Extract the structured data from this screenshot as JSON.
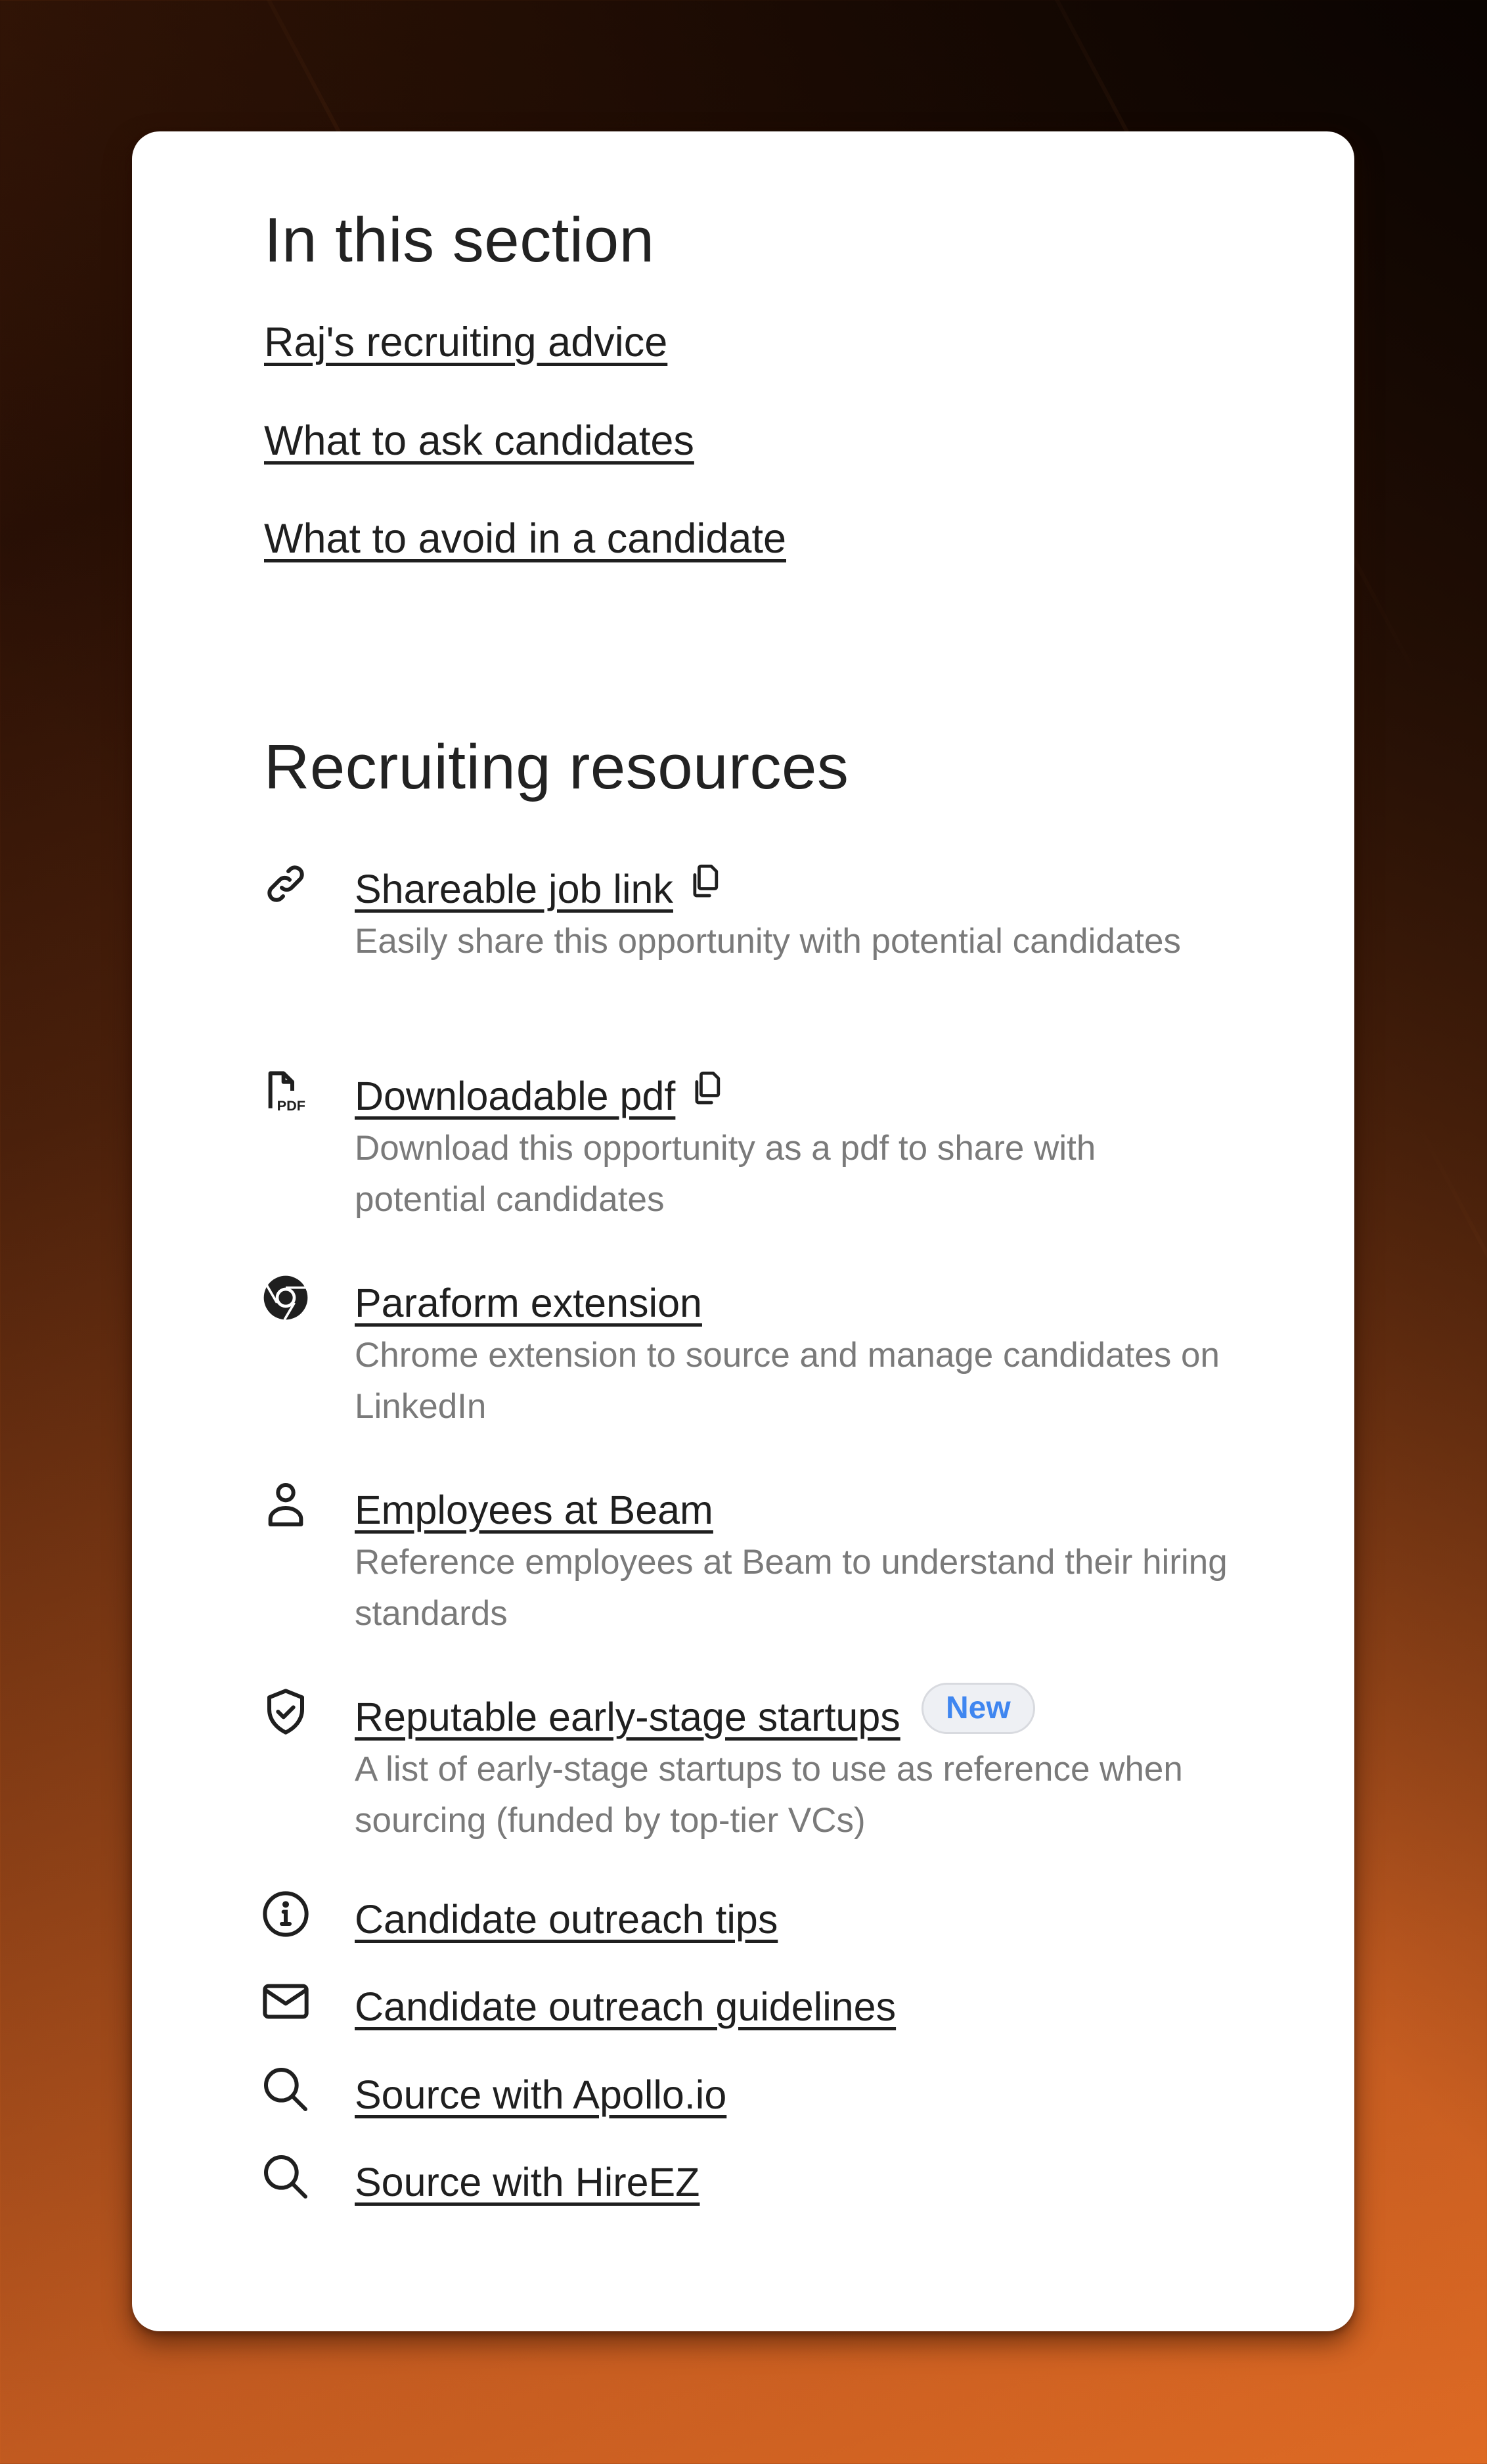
{
  "in_this_section": {
    "heading": "In this section",
    "links": [
      {
        "label": "Raj's recruiting advice"
      },
      {
        "label": "What to ask candidates"
      },
      {
        "label": "What to avoid in a candidate"
      }
    ]
  },
  "recruiting_resources": {
    "heading": "Recruiting resources",
    "items": [
      {
        "icon": "link-icon",
        "title": "Shareable job link",
        "has_copy": true,
        "description": "Easily share this opportunity with potential candidates"
      },
      {
        "icon": "pdf-file-icon",
        "title": "Downloadable pdf",
        "has_copy": true,
        "description": "Download this opportunity as a pdf to share with potential candidates"
      },
      {
        "icon": "chrome-icon",
        "title": "Paraform extension",
        "description": "Chrome extension to source and manage candidates on LinkedIn"
      },
      {
        "icon": "user-icon",
        "title": "Employees at Beam",
        "description": "Reference employees at Beam to understand their hiring standards"
      },
      {
        "icon": "shield-check-icon",
        "title": "Reputable early-stage startups",
        "badge": "New",
        "description": "A list of early-stage startups to use as reference when sourcing (funded by top-tier VCs)"
      },
      {
        "icon": "info-icon",
        "title": "Candidate outreach tips"
      },
      {
        "icon": "mail-icon",
        "title": "Candidate outreach guidelines"
      },
      {
        "icon": "search-icon",
        "title": "Source with Apollo.io"
      },
      {
        "icon": "search-icon",
        "title": "Source with HireEZ"
      }
    ]
  },
  "colors": {
    "text_primary": "#1f1f1f",
    "text_secondary": "#7a7a7a",
    "badge_text": "#3f86f0",
    "badge_bg": "#eef0f4",
    "background_orange": "#de6a24",
    "background_dark": "#0a0402"
  }
}
